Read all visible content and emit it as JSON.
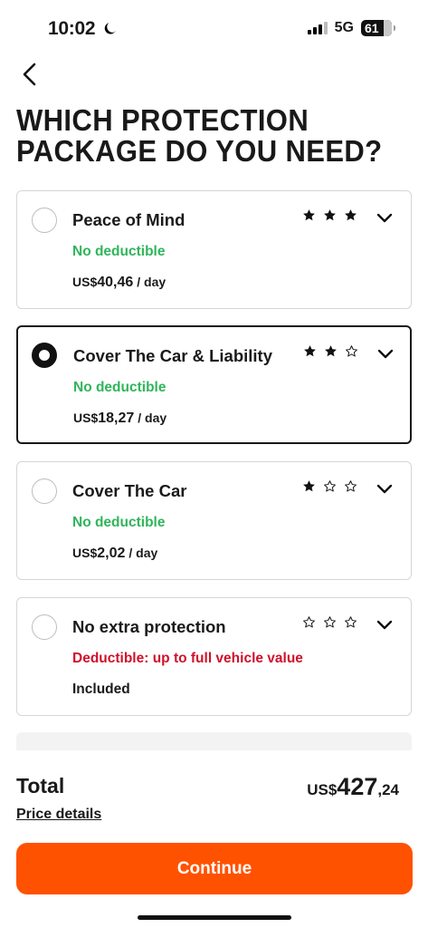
{
  "status_bar": {
    "time": "10:02",
    "network": "5G",
    "battery": "61"
  },
  "header": {
    "title": "WHICH PROTECTION PACKAGE DO YOU NEED?"
  },
  "packages": [
    {
      "name": "Peace of Mind",
      "subtitle": "No deductible",
      "subtitle_color": "#2fb55b",
      "price_currency": "US$",
      "price_amount": "40,46",
      "price_period": "/ day",
      "stars_filled": 3,
      "stars_total": 3,
      "selected": false
    },
    {
      "name": "Cover The Car & Liability",
      "subtitle": "No deductible",
      "subtitle_color": "#2fb55b",
      "price_currency": "US$",
      "price_amount": "18,27",
      "price_period": "/ day",
      "stars_filled": 2,
      "stars_total": 3,
      "selected": true
    },
    {
      "name": "Cover The Car",
      "subtitle": "No deductible",
      "subtitle_color": "#2fb55b",
      "price_currency": "US$",
      "price_amount": "2,02",
      "price_period": "/ day",
      "stars_filled": 1,
      "stars_total": 3,
      "selected": false
    },
    {
      "name": "No extra protection",
      "subtitle": "Deductible: up to full vehicle value",
      "subtitle_color": "#d0112b",
      "included_label": "Included",
      "stars_filled": 0,
      "stars_total": 3,
      "selected": false
    }
  ],
  "footer": {
    "total_label": "Total",
    "total_currency": "US$",
    "total_int": "427",
    "total_dec": ",24",
    "price_details_label": "Price details",
    "continue_label": "Continue",
    "accent_color": "#ff5200"
  }
}
